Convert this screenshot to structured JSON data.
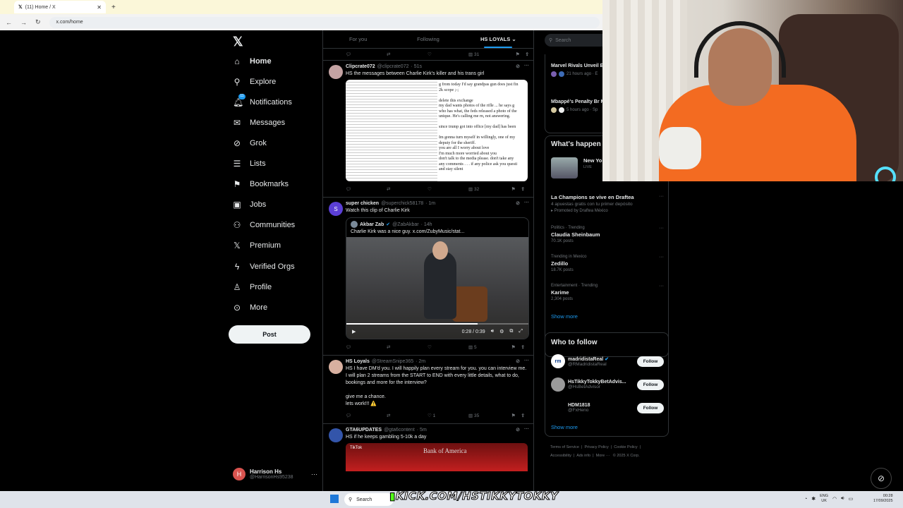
{
  "browser": {
    "tab_title": "(11) Home / X",
    "url": "x.com/home"
  },
  "nav": {
    "items": [
      {
        "label": "Home",
        "icon": "home-icon"
      },
      {
        "label": "Explore",
        "icon": "search-icon"
      },
      {
        "label": "Notifications",
        "icon": "bell-icon",
        "badge": "11"
      },
      {
        "label": "Messages",
        "icon": "envelope-icon"
      },
      {
        "label": "Grok",
        "icon": "grok-icon"
      },
      {
        "label": "Lists",
        "icon": "list-icon"
      },
      {
        "label": "Bookmarks",
        "icon": "bookmark-icon"
      },
      {
        "label": "Jobs",
        "icon": "briefcase-icon"
      },
      {
        "label": "Communities",
        "icon": "people-icon"
      },
      {
        "label": "Premium",
        "icon": "x-icon"
      },
      {
        "label": "Verified Orgs",
        "icon": "lightning-icon"
      },
      {
        "label": "Profile",
        "icon": "person-icon"
      },
      {
        "label": "More",
        "icon": "more-circle-icon"
      }
    ],
    "post_label": "Post",
    "account": {
      "name": "Harrison Hs",
      "handle": "@HarrisonHs95238",
      "initial": "H"
    }
  },
  "feed": {
    "tabs": [
      "For you",
      "Following",
      "HS LOYALS"
    ],
    "top_actions": {
      "views": "31"
    },
    "posts": [
      {
        "name": "Clipcrate072",
        "handle": "@clipcrate072",
        "time": "· 51s",
        "text": "HS the messages between Charlie Kirk's killer and his trans girl",
        "image_text": "g from today I'd say grandpas gun does just fin\n2k scope ;-;\n\ndelete this exchange\nmy dad wants photos of the rifle ... he says g\nwho has what, the feds released a photo of the\nunique. He's calling me rn, not answering.\n\nsince trump got into office [my dad] has been\n\nIm gonna turn myself in willingly, one of my\ndeputy for the sheriff.\nyou are all I worry about love\nI'm much more worried about you\ndon't talk to the media please. don't take any\nany comments . . . if any police ask you questi\nand stay silent",
        "views": "32"
      },
      {
        "name": "super chicken",
        "handle": "@superchick58178",
        "time": "· 1m",
        "initial": "S",
        "text": "Watch this clip of Charlie Kirk",
        "quote": {
          "name": "Akbar Zab",
          "handle": "@ZabAkbar",
          "time": "· 14h",
          "text": "Charlie Kirk was a nice guy.  x.com/ZubyMusic/stat...",
          "video_time": "0:28 / 0:39"
        },
        "views": "5"
      },
      {
        "name": "HS Loyals",
        "handle": "@StreamSnipe365",
        "time": "· 2m",
        "text": "HS I have DM'd you. I will happily plan every stream for you. you can interview me. I will plan 2 streams from the START to END with every little details, what to do, bookings and more for the interview?\n\ngive me a chance.\nlets work!!! ⚠️",
        "likes": "1",
        "views": "35"
      },
      {
        "name": "GTA6UPDATES",
        "handle": "@gta6content",
        "time": "· 5m",
        "text": "HS if he keeps gambling 5-10k a day",
        "image_text": "Bank of America",
        "image_badge": "TikTok"
      }
    ]
  },
  "sidebar": {
    "search_placeholder": "Search",
    "news": [
      {
        "title": "Marvel Rivals Unveil Event Pass Septemb",
        "meta": "21 hours ago · E"
      },
      {
        "title": "Mbappé's Penalty Br Madrid's 2-1 UCL Wi",
        "meta": "5 hours ago · Sp"
      }
    ],
    "happening_title": "What's happen",
    "live": {
      "title": "New Yo",
      "badge": "LIVE"
    },
    "trends": [
      {
        "category": "",
        "title": "La Champions se vive en Draftea",
        "posts": "4 apuestas gratis con tu primer depósito",
        "promo": "Promoted by Draftea México"
      },
      {
        "category": "Politics · Trending",
        "title": "Claudia Sheinbaum",
        "posts": "70.1K posts"
      },
      {
        "category": "Trending in Mexico",
        "title": "Zedillo",
        "posts": "18.7K posts"
      },
      {
        "category": "Entertainment · Trending",
        "title": "Karime",
        "posts": "2,304 posts"
      }
    ],
    "show_more": "Show more",
    "who_to_follow": {
      "title": "Who to follow",
      "accounts": [
        {
          "name": "madridistaReal",
          "handle": "@RMadridistaReal",
          "avatar": "rm",
          "verified": true
        },
        {
          "name": "HsTikkyTokkyBetAdvis...",
          "handle": "@HsBetAdvisor",
          "avatar": ""
        },
        {
          "name": "HDM1818",
          "handle": "@FxHeno",
          "avatar": ""
        }
      ],
      "follow_label": "Follow",
      "show_more": "Show more"
    },
    "footer": [
      "Terms of Service",
      "Privacy Policy",
      "Cookie Policy",
      "Accessibility",
      "Ads info",
      "More ···",
      "© 2025 X Corp."
    ]
  },
  "overlay": {
    "kick_text": "KICK.COM/HSTIKKYTOKKY"
  },
  "taskbar": {
    "search": "Search",
    "lang_line1": "ENG",
    "lang_line2": "UK",
    "time": "00:28",
    "date": "17/09/2025"
  },
  "colors": {
    "accent": "#1d9bf0",
    "kick_green": "#53fc18",
    "shirt": "#f36b21"
  }
}
